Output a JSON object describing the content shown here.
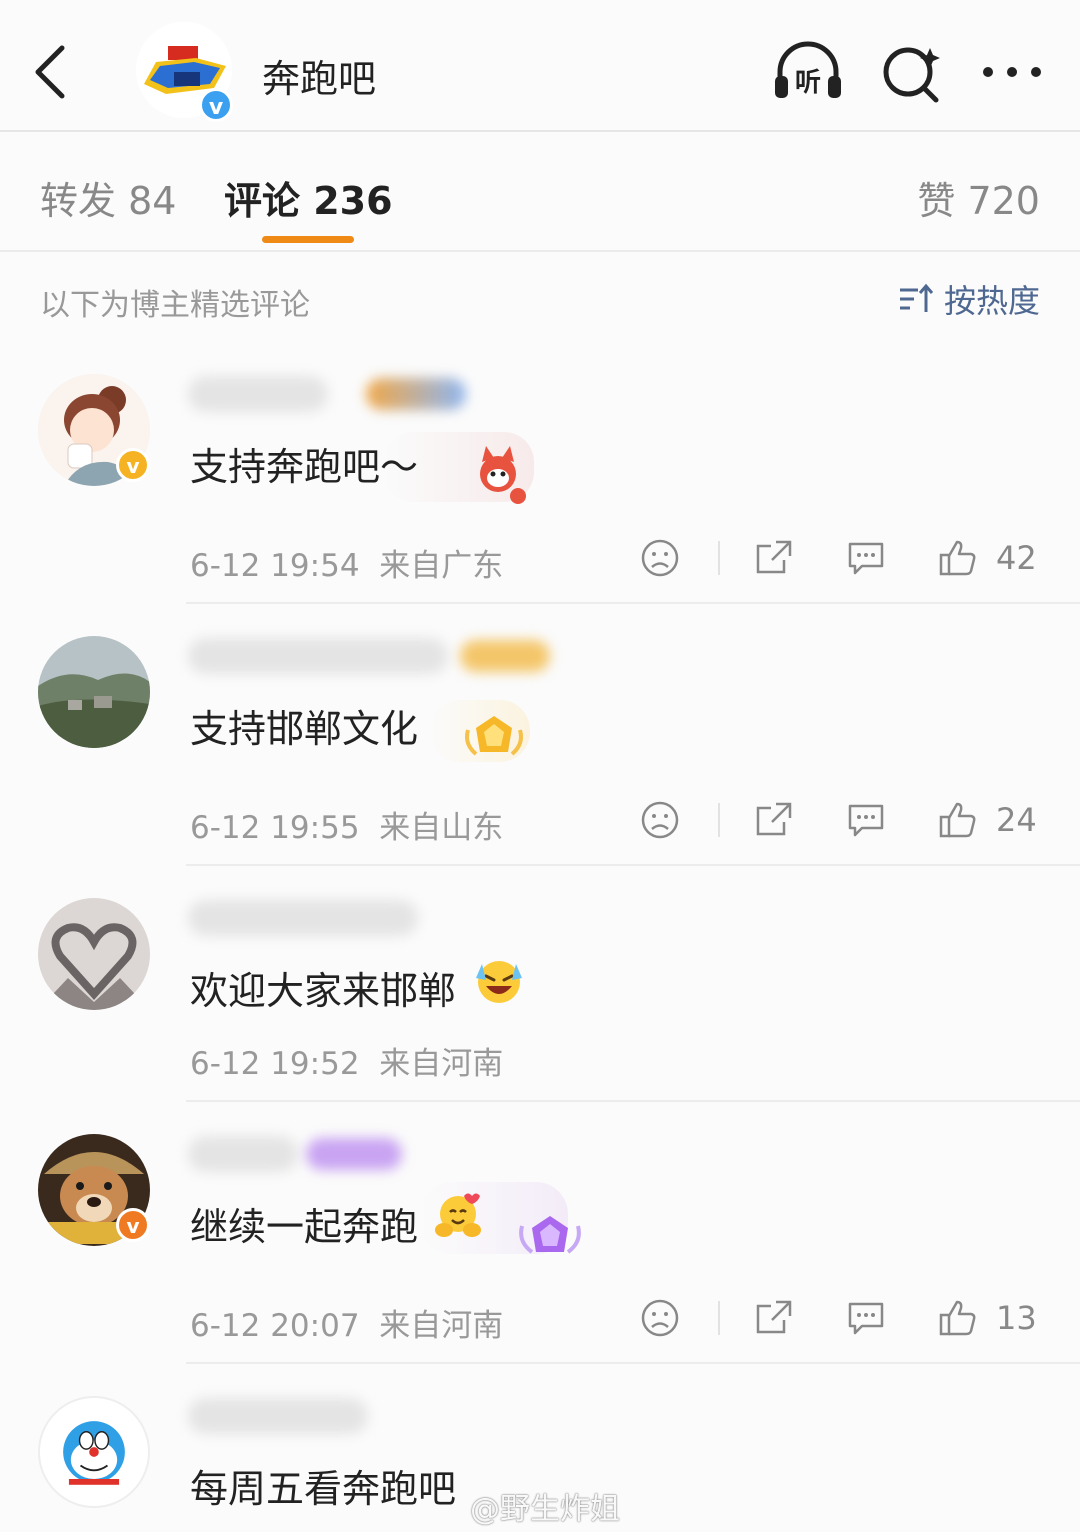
{
  "header": {
    "title": "奔跑吧",
    "listen_label": "听"
  },
  "tabs": [
    {
      "label": "转发 84"
    },
    {
      "label": "评论 236"
    },
    {
      "label": "赞 720"
    }
  ],
  "filter": {
    "note": "以下为博主精选评论",
    "sort_label": "按热度"
  },
  "comments": [
    {
      "text": "支持奔跑吧～",
      "time": "6-12 19:54",
      "location": "来自广东",
      "likes": "42"
    },
    {
      "text": "支持邯郸文化",
      "time": "6-12 19:55",
      "location": "来自山东",
      "likes": "24"
    },
    {
      "text": "欢迎大家来邯郸",
      "time": "6-12 19:52",
      "location": "来自河南",
      "likes": ""
    },
    {
      "text": "继续一起奔跑",
      "time": "6-12 20:07",
      "location": "来自河南",
      "likes": "13"
    },
    {
      "text": "每周五看奔跑吧",
      "time": "",
      "location": "",
      "likes": ""
    }
  ],
  "watermark": "@野生炸姐",
  "colors": {
    "accent": "#f08a17",
    "link": "#4f6891",
    "verified_blue": "#3aa0ef",
    "verified_gold": "#f5b324"
  }
}
